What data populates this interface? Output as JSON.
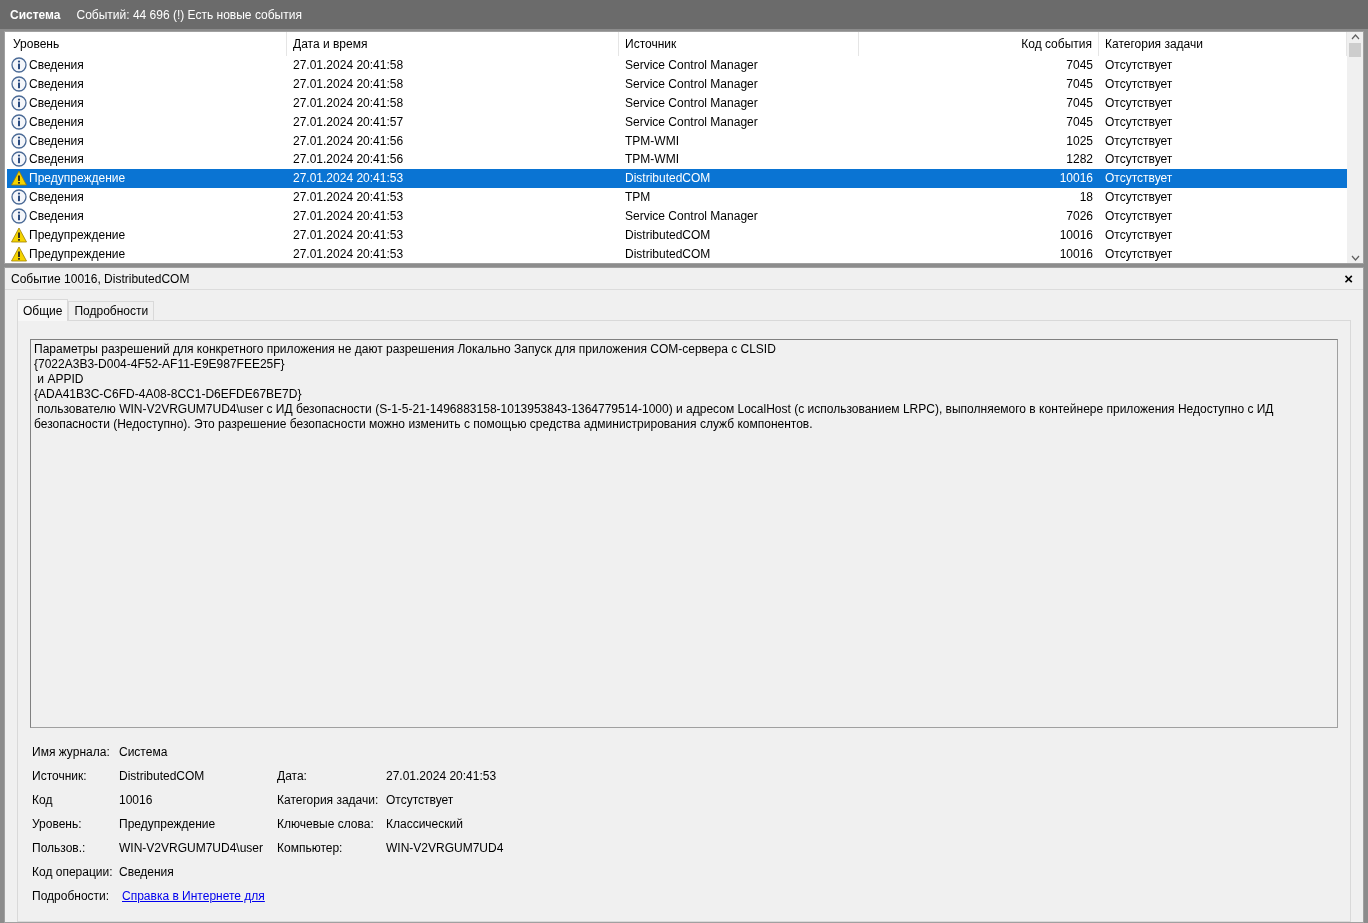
{
  "header": {
    "title": "Система",
    "summary": "Событий: 44 696 (!) Есть новые события"
  },
  "table": {
    "columns": [
      "Уровень",
      "Дата и время",
      "Источник",
      "Код события",
      "Категория задачи"
    ],
    "rows": [
      {
        "kind": "info",
        "level": "Сведения",
        "datetime": "27.01.2024 20:41:58",
        "source": "Service Control Manager",
        "code": "7045",
        "category": "Отсутствует",
        "selected": false
      },
      {
        "kind": "info",
        "level": "Сведения",
        "datetime": "27.01.2024 20:41:58",
        "source": "Service Control Manager",
        "code": "7045",
        "category": "Отсутствует",
        "selected": false
      },
      {
        "kind": "info",
        "level": "Сведения",
        "datetime": "27.01.2024 20:41:58",
        "source": "Service Control Manager",
        "code": "7045",
        "category": "Отсутствует",
        "selected": false
      },
      {
        "kind": "info",
        "level": "Сведения",
        "datetime": "27.01.2024 20:41:57",
        "source": "Service Control Manager",
        "code": "7045",
        "category": "Отсутствует",
        "selected": false
      },
      {
        "kind": "info",
        "level": "Сведения",
        "datetime": "27.01.2024 20:41:56",
        "source": "TPM-WMI",
        "code": "1025",
        "category": "Отсутствует",
        "selected": false
      },
      {
        "kind": "info",
        "level": "Сведения",
        "datetime": "27.01.2024 20:41:56",
        "source": "TPM-WMI",
        "code": "1282",
        "category": "Отсутствует",
        "selected": false
      },
      {
        "kind": "warning",
        "level": "Предупреждение",
        "datetime": "27.01.2024 20:41:53",
        "source": "DistributedCOM",
        "code": "10016",
        "category": "Отсутствует",
        "selected": true
      },
      {
        "kind": "info",
        "level": "Сведения",
        "datetime": "27.01.2024 20:41:53",
        "source": "TPM",
        "code": "18",
        "category": "Отсутствует",
        "selected": false
      },
      {
        "kind": "info",
        "level": "Сведения",
        "datetime": "27.01.2024 20:41:53",
        "source": "Service Control Manager",
        "code": "7026",
        "category": "Отсутствует",
        "selected": false
      },
      {
        "kind": "warning",
        "level": "Предупреждение",
        "datetime": "27.01.2024 20:41:53",
        "source": "DistributedCOM",
        "code": "10016",
        "category": "Отсутствует",
        "selected": false
      },
      {
        "kind": "warning",
        "level": "Предупреждение",
        "datetime": "27.01.2024 20:41:53",
        "source": "DistributedCOM",
        "code": "10016",
        "category": "Отсутствует",
        "selected": false
      }
    ]
  },
  "detail": {
    "title": "Событие 10016, DistributedCOM",
    "close": "×",
    "tabs": [
      {
        "label": "Общие",
        "selected": true
      },
      {
        "label": "Подробности",
        "selected": false
      }
    ],
    "message": "Параметры разрешений для конкретного приложения не дают разрешения Локально Запуск для приложения COM-сервера с CLSID\n{7022A3B3-D004-4F52-AF11-E9E987FEE25F}\n и APPID\n{ADA41B3C-C6FD-4A08-8CC1-D6EFDE67BE7D}\n пользователю WIN-V2VRGUM7UD4\\user с ИД безопасности (S-1-5-21-1496883158-1013953843-1364779514-1000) и адресом LocalHost (с использованием LRPC), выполняемого в контейнере приложения Недоступно с ИД безопасности (Недоступно). Это разрешение безопасности можно изменить с помощью средства администрирования служб компонентов.",
    "properties": [
      {
        "label": "Имя журнала:",
        "value": "Система"
      },
      {
        "label": "Источник:",
        "value": "DistributedCOM",
        "label2": "Дата:",
        "value2": "27.01.2024 20:41:53"
      },
      {
        "label": "Код",
        "value": "10016",
        "label2": "Категория задачи:",
        "value2": "Отсутствует"
      },
      {
        "label": "Уровень:",
        "value": "Предупреждение",
        "label2": "Ключевые слова:",
        "value2": "Классический"
      },
      {
        "label": "Пользов.:",
        "value": "WIN-V2VRGUM7UD4\\user",
        "label2": "Компьютер:",
        "value2": "WIN-V2VRGUM7UD4"
      },
      {
        "label": "Код операции:",
        "value": "Сведения"
      },
      {
        "label": "Подробности:",
        "link": "Справка в Интернете для"
      }
    ]
  }
}
